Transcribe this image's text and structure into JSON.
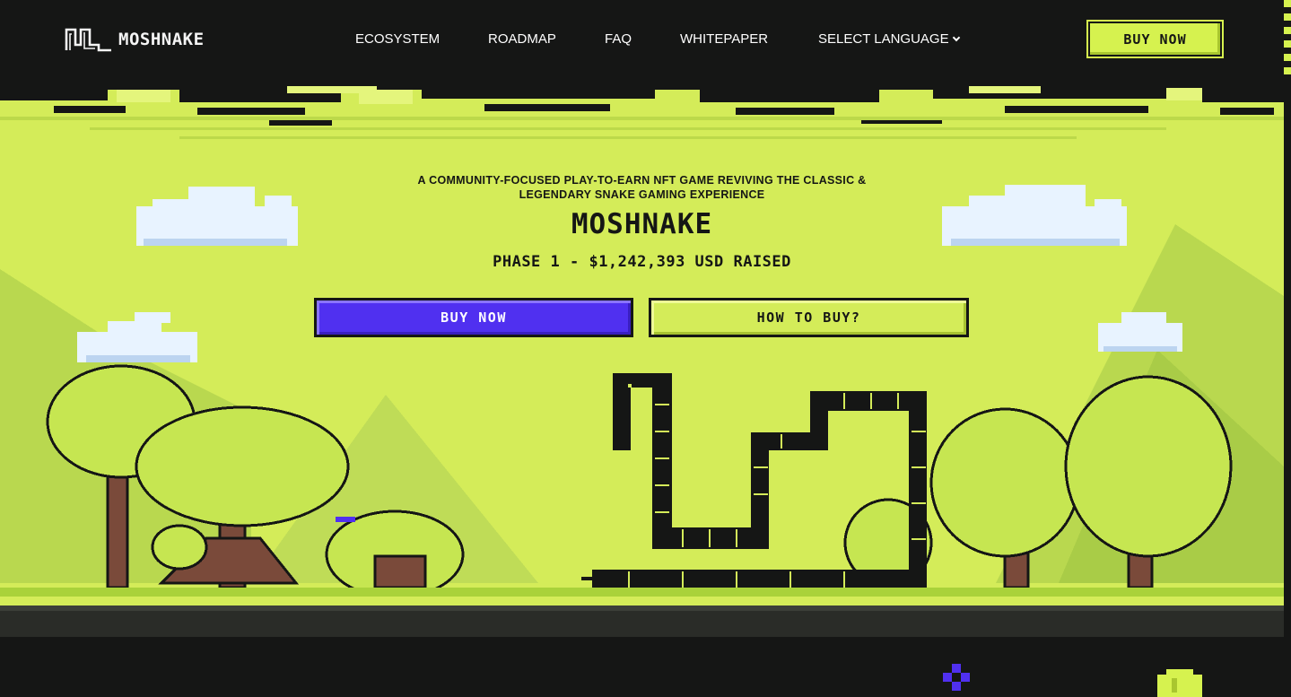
{
  "brand": {
    "name": "MOSHNAKE"
  },
  "nav": {
    "links": [
      "ECOSYSTEM",
      "ROADMAP",
      "FAQ",
      "WHITEPAPER",
      "SELECT LANGUAGE"
    ],
    "buy_label": "BUY NOW"
  },
  "hero": {
    "tagline": "A COMMUNITY-FOCUSED PLAY-TO-EARN NFT GAME REVIVING THE CLASSIC & LEGENDARY SNAKE GAMING EXPERIENCE",
    "title": "MOSHNAKE",
    "raised": "PHASE 1 - $1,242,393 USD RAISED",
    "primary_button": "BUY NOW",
    "secondary_button": "HOW TO BUY?"
  },
  "colors": {
    "accent_lime": "#d6f24f",
    "accent_purple": "#5030f0",
    "background_dark": "#151615",
    "hero_background": "#d4ec59"
  },
  "icons": [
    "moshnake-logo-icon",
    "chevron-down-icon",
    "snake-icon",
    "purple-gem-icon",
    "coin-icon"
  ]
}
